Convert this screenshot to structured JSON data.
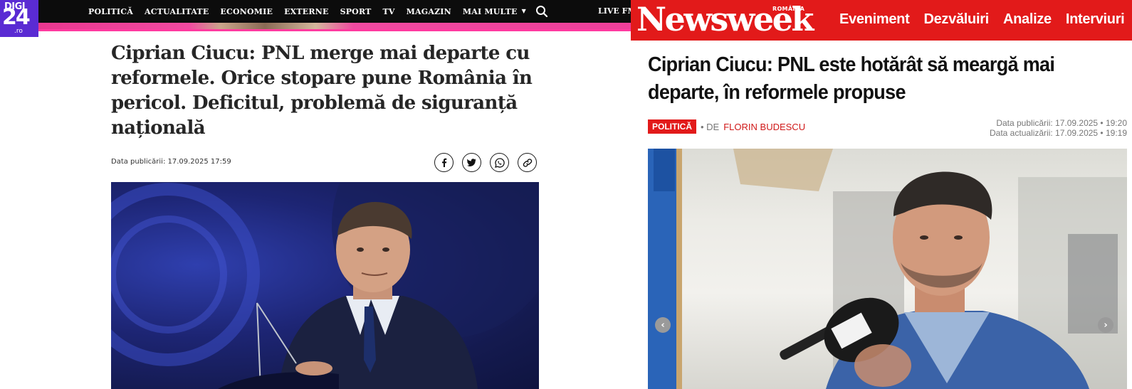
{
  "digi24": {
    "logo": {
      "top": "DIGI",
      "main": "24",
      "suffix": ".ro"
    },
    "nav": {
      "items": [
        "POLITICĂ",
        "ACTUALITATE",
        "ECONOMIE",
        "EXTERNE",
        "SPORT",
        "TV",
        "MAGAZIN",
        "MAI MULTE"
      ],
      "live_label": "LIVE FM"
    },
    "article": {
      "title": "Ciprian Ciucu: PNL merge mai departe cu reformele. Orice stopare pune România în pericol. Deficitul, problemă de siguranță națională",
      "date_label": "Data publicării:",
      "date_value": "17.09.2025 17:59"
    },
    "share_icons": [
      "facebook-icon",
      "x-twitter-icon",
      "whatsapp-icon",
      "copy-link-icon"
    ],
    "colors": {
      "nav_bg": "#0c0c0c",
      "logo_bg": "#5a2bd3",
      "accent_pink": "#ee3f9a",
      "title": "#262626"
    }
  },
  "newsweek": {
    "logo": {
      "name": "Newsweek",
      "edition": "ROMÂNIA"
    },
    "nav": {
      "items": [
        "Eveniment",
        "Dezvăluiri",
        "Analize",
        "Interviuri"
      ]
    },
    "article": {
      "title": "Ciprian Ciucu: PNL este hotărât să meargă mai departe, în reformele propuse",
      "category": "POLITICĂ",
      "by_label": "• DE",
      "author": "FLORIN BUDESCU",
      "published": "Data publicării: 17.09.2025 • 19:20",
      "updated": "Data actualizării: 17.09.2025 • 19:19"
    },
    "carousel": {
      "prev_icon": "chevron-left-icon",
      "next_icon": "chevron-right-icon"
    },
    "colors": {
      "brand_red": "#e21a1a",
      "author_red": "#d01818",
      "meta_grey": "#777777"
    }
  }
}
